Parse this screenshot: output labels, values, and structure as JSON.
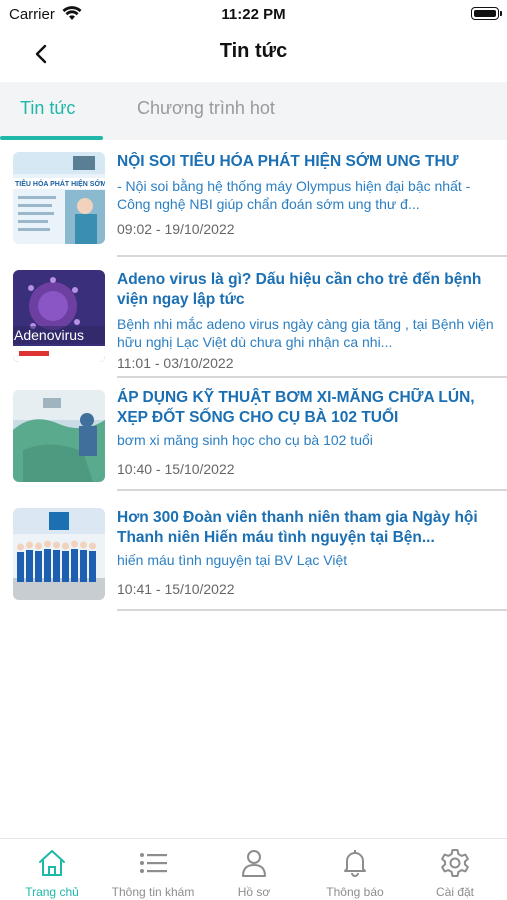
{
  "status": {
    "carrier": "Carrier",
    "time": "11:22 PM"
  },
  "nav": {
    "title": "Tin tức"
  },
  "tabs": [
    {
      "label": "Tin tức",
      "active": true
    },
    {
      "label": "Chương trình hot",
      "active": false
    }
  ],
  "news": [
    {
      "title": "NỘI SOI TIÊU HÓA PHÁT HIỆN SỚM UNG THƯ",
      "summary": "- Nội soi bằng hệ thống máy Olympus hiện đại bậc nhất - Công nghệ NBI giúp chẩn đoán sớm ung thư đ...",
      "date": "09:02 - 19/10/2022",
      "thumb_text": "TIÊU HÓA PHÁT HIỆN SỚM U"
    },
    {
      "title": "Adeno virus là gì? Dấu hiệu cần cho trẻ đến bệnh viện ngay lập tức",
      "summary": "Bệnh nhi mắc adeno virus ngày càng gia tăng , tại Bệnh viện hữu nghị Lạc Việt dù chưa ghi nhận ca nhi...",
      "date": "11:01 - 03/10/2022",
      "thumb_text": "Adenovirus"
    },
    {
      "title": "ÁP DỤNG KỸ THUẬT BƠM XI-MĂNG CHỮA LÚN, XẸP ĐỐT SỐNG CHO CỤ BÀ 102 TUỔI",
      "summary": "bơm xi măng sinh học cho cụ bà 102 tuổi",
      "date": "10:40 - 15/10/2022"
    },
    {
      "title": "Hơn 300 Đoàn viên thanh niên tham gia Ngày hội Thanh niên Hiến máu tình nguyện tại Bện...",
      "summary": "hiến máu tình nguyện tại BV Lạc Việt",
      "date": "10:41 - 15/10/2022"
    }
  ],
  "bottom_nav": [
    {
      "label": "Trang chủ",
      "icon": "home-icon",
      "active": true
    },
    {
      "label": "Thông tin khám",
      "icon": "list-icon",
      "active": false
    },
    {
      "label": "Hồ sơ",
      "icon": "user-icon",
      "active": false
    },
    {
      "label": "Thông báo",
      "icon": "bell-icon",
      "active": false
    },
    {
      "label": "Cài đặt",
      "icon": "gear-icon",
      "active": false
    }
  ],
  "colors": {
    "accent": "#1eb7a9",
    "link": "#1b6fb3",
    "tab_bg": "#f3f4f6"
  }
}
